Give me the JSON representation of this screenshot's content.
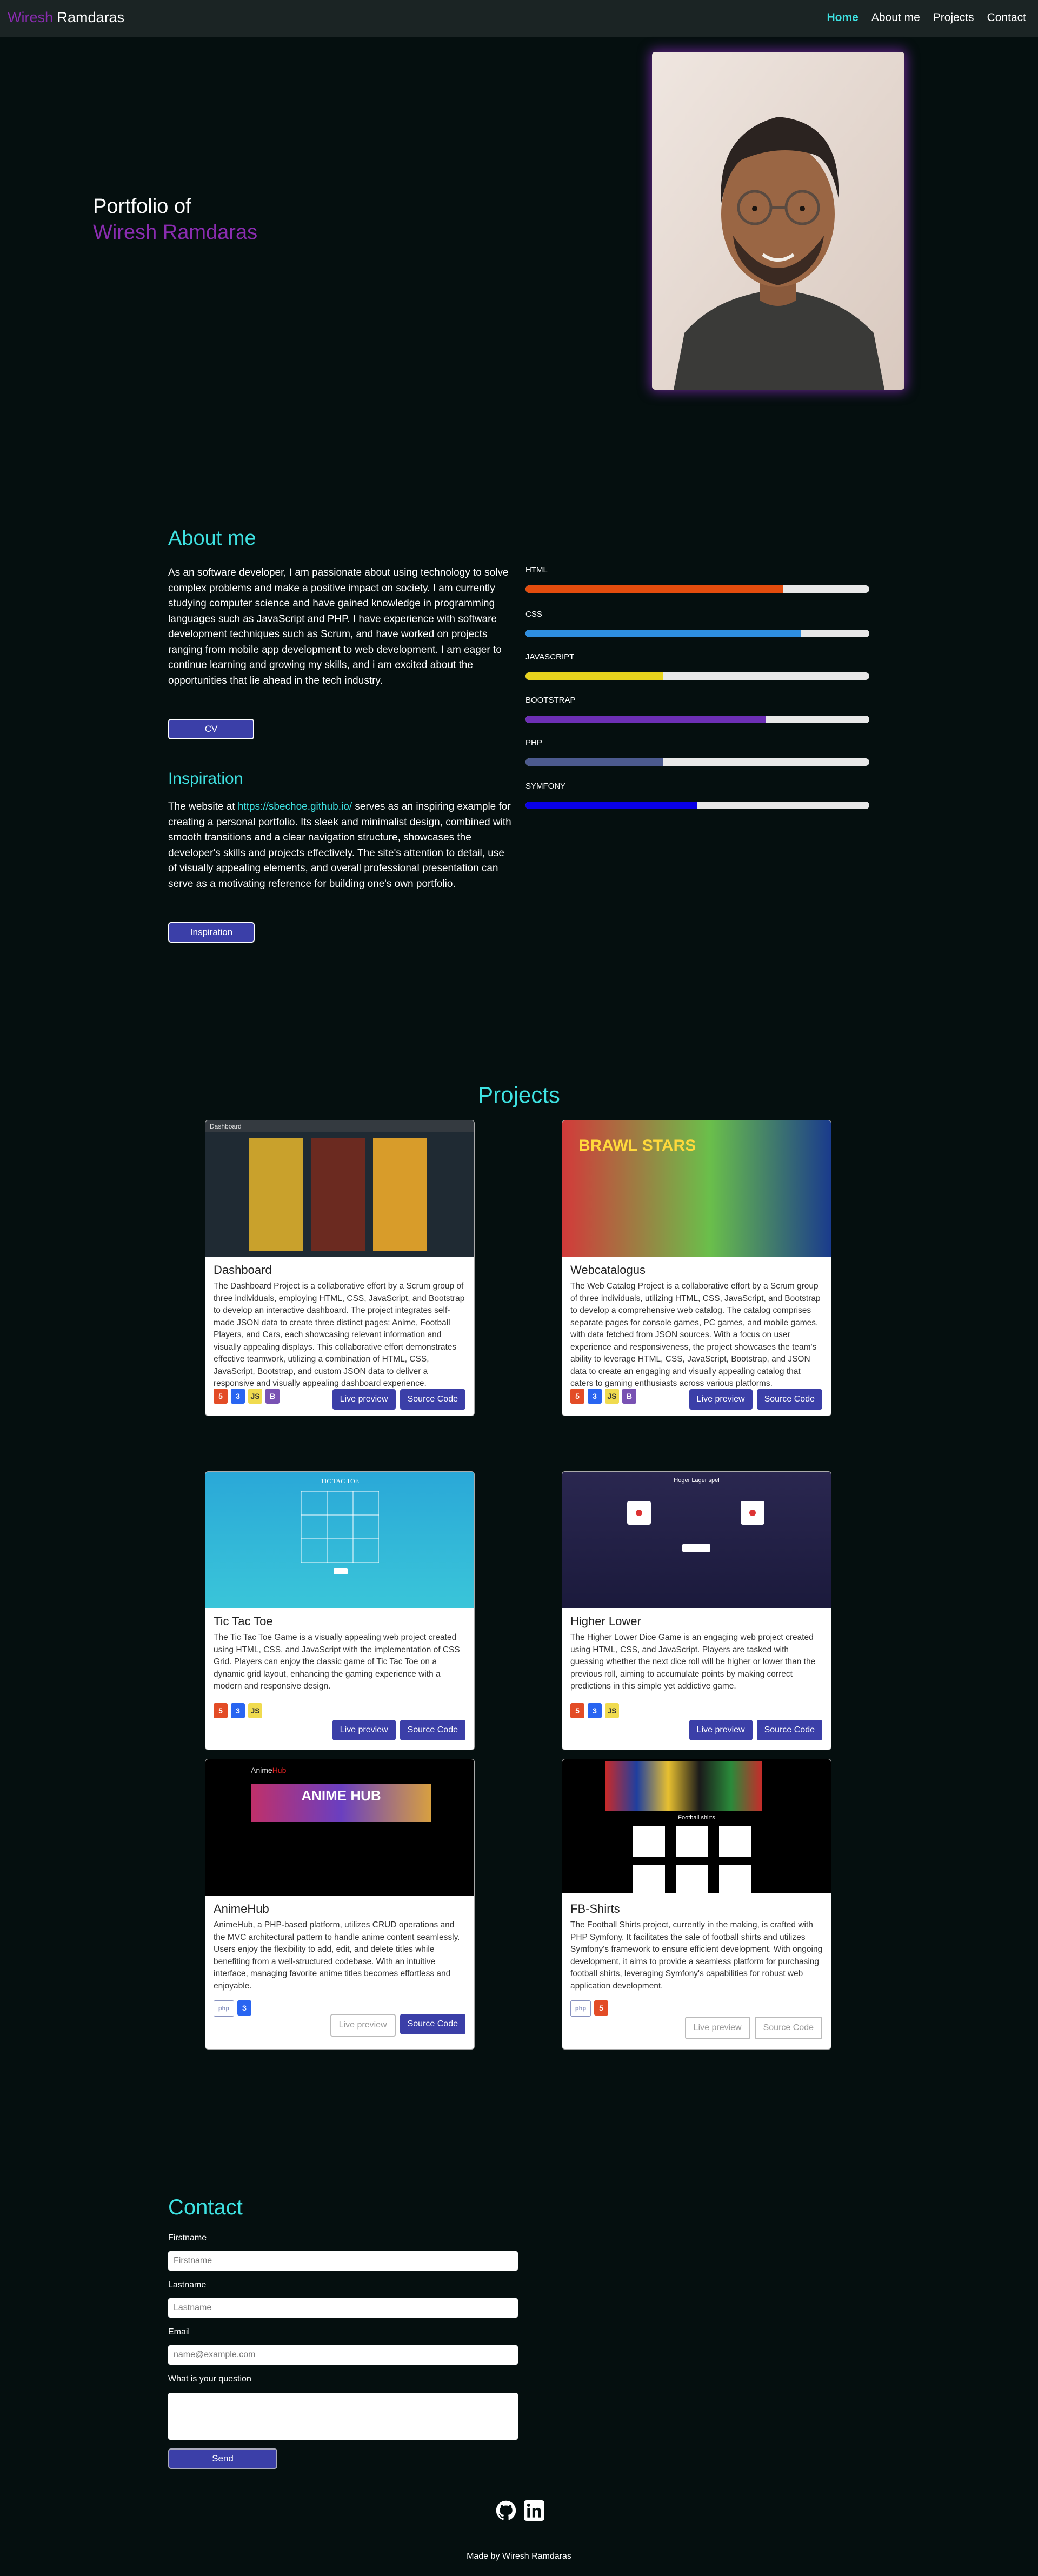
{
  "nav": {
    "brand_first": "Wiresh",
    "brand_last": "Ramdaras",
    "items": [
      "Home",
      "About me",
      "Projects",
      "Contact"
    ]
  },
  "hero": {
    "title": "Portfolio of",
    "name": "Wiresh Ramdaras",
    "photo_icon": "portrait-photo"
  },
  "about": {
    "heading": "About me",
    "text": "As an software developer, I am passionate about using technology to solve complex problems and make a positive impact on society. I am currently studying computer science and have gained knowledge in programming languages such as JavaScript and PHP. I have experience with software development techniques such as Scrum, and have worked on projects ranging from mobile app development to web development. I am eager to continue learning and growing my skills, and i am excited about the opportunities that lie ahead in the tech industry.",
    "cv_button": "CV",
    "inspiration_heading": "Inspiration",
    "inspiration_before": "The website at ",
    "inspiration_link": "https://sbechoe.github.io/",
    "inspiration_after": " serves as an inspiring example for creating a personal portfolio. Its sleek and minimalist design, combined with smooth transitions and a clear navigation structure, showcases the developer's skills and projects effectively. The site's attention to detail, use of visually appealing elements, and overall professional presentation can serve as a motivating reference for building one's own portfolio.",
    "inspiration_button": "Inspiration"
  },
  "skills": [
    {
      "name": "HTML",
      "level": 0.75,
      "color": "#e34c0d"
    },
    {
      "name": "CSS",
      "level": 0.8,
      "color": "#2e8ee0"
    },
    {
      "name": "JAVASCRIPT",
      "level": 0.4,
      "color": "#e8d31d"
    },
    {
      "name": "BOOTSTRAP",
      "level": 0.7,
      "color": "#6d2fb5"
    },
    {
      "name": "PHP",
      "level": 0.4,
      "color": "#4c5a8e"
    },
    {
      "name": "SYMFONY",
      "level": 0.5,
      "color": "#0a00e6"
    }
  ],
  "projects": {
    "heading": "Projects",
    "items": [
      {
        "title": "Dashboard",
        "desc": "The Dashboard Project is a collaborative effort by a Scrum group of three individuals, employing HTML, CSS, JavaScript, and Bootstrap to develop an interactive dashboard. The project integrates self-made JSON data to create three distinct pages: Anime, Football Players, and Cars, each showcasing relevant information and visually appealing displays. This collaborative effort demonstrates effective teamwork, utilizing a combination of HTML, CSS, JavaScript, Bootstrap, and custom JSON data to deliver a responsive and visually appealing dashboard experience.",
        "live": "Live preview",
        "source": "Source Code",
        "screenshot_label": "Dashboard"
      },
      {
        "title": "Webcatalogus",
        "desc": "The Web Catalog Project is a collaborative effort by a Scrum group of three individuals, utilizing HTML, CSS, JavaScript, and Bootstrap to develop a comprehensive web catalog. The catalog comprises separate pages for console games, PC games, and mobile games, with data fetched from JSON sources. With a focus on user experience and responsiveness, the project showcases the team's ability to leverage HTML, CSS, JavaScript, Bootstrap, and JSON data to create an engaging and visually appealing catalog that caters to gaming enthusiasts across various platforms.",
        "live": "Live preview",
        "source": "Source Code",
        "screenshot_label": "BRAWL STARS"
      },
      {
        "title": "Tic Tac Toe",
        "desc": "The Tic Tac Toe Game is a visually appealing web project created using HTML, CSS, and JavaScript with the implementation of CSS Grid. Players can enjoy the classic game of Tic Tac Toe on a dynamic grid layout, enhancing the gaming experience with a modern and responsive design.",
        "live": "Live preview",
        "source": "Source Code",
        "screenshot_label": "TIC TAC TOE"
      },
      {
        "title": "Higher Lower",
        "desc": "The Higher Lower Dice Game is an engaging web project created using HTML, CSS, and JavaScript. Players are tasked with guessing whether the next dice roll will be higher or lower than the previous roll, aiming to accumulate points by making correct predictions in this simple yet addictive game.",
        "live": "Live preview",
        "source": "Source Code",
        "screenshot_label": "Hoger Lager spel"
      },
      {
        "title": "AnimeHub",
        "desc": "AnimeHub, a PHP-based platform, utilizes CRUD operations and the MVC architectural pattern to handle anime content seamlessly. Users enjoy the flexibility to add, edit, and delete titles while benefiting from a well-structured codebase. With an intuitive interface, managing favorite anime titles becomes effortless and enjoyable.",
        "live": "Live preview",
        "source": "Source Code",
        "screenshot_label": "ANIME HUB"
      },
      {
        "title": "FB-Shirts",
        "desc": "The Football Shirts project, currently in the making, is crafted with PHP Symfony. It facilitates the sale of football shirts and utilizes Symfony's framework to ensure efficient development. With ongoing development, it aims to provide a seamless platform for purchasing football shirts, leveraging Symfony's capabilities for robust web application development.",
        "live": "Live preview",
        "source": "Source Code",
        "screenshot_label": "Football shirts"
      }
    ]
  },
  "contact": {
    "heading": "Contact",
    "firstname_label": "Firstname",
    "firstname_placeholder": "Firstname",
    "lastname_label": "Lastname",
    "lastname_placeholder": "Lastname",
    "email_label": "Email",
    "email_placeholder": "name@example.com",
    "question_label": "What is your question",
    "send": "Send"
  },
  "footer": {
    "text": "Made by Wiresh Ramdaras",
    "icons": [
      "github-icon",
      "linkedin-icon"
    ]
  }
}
